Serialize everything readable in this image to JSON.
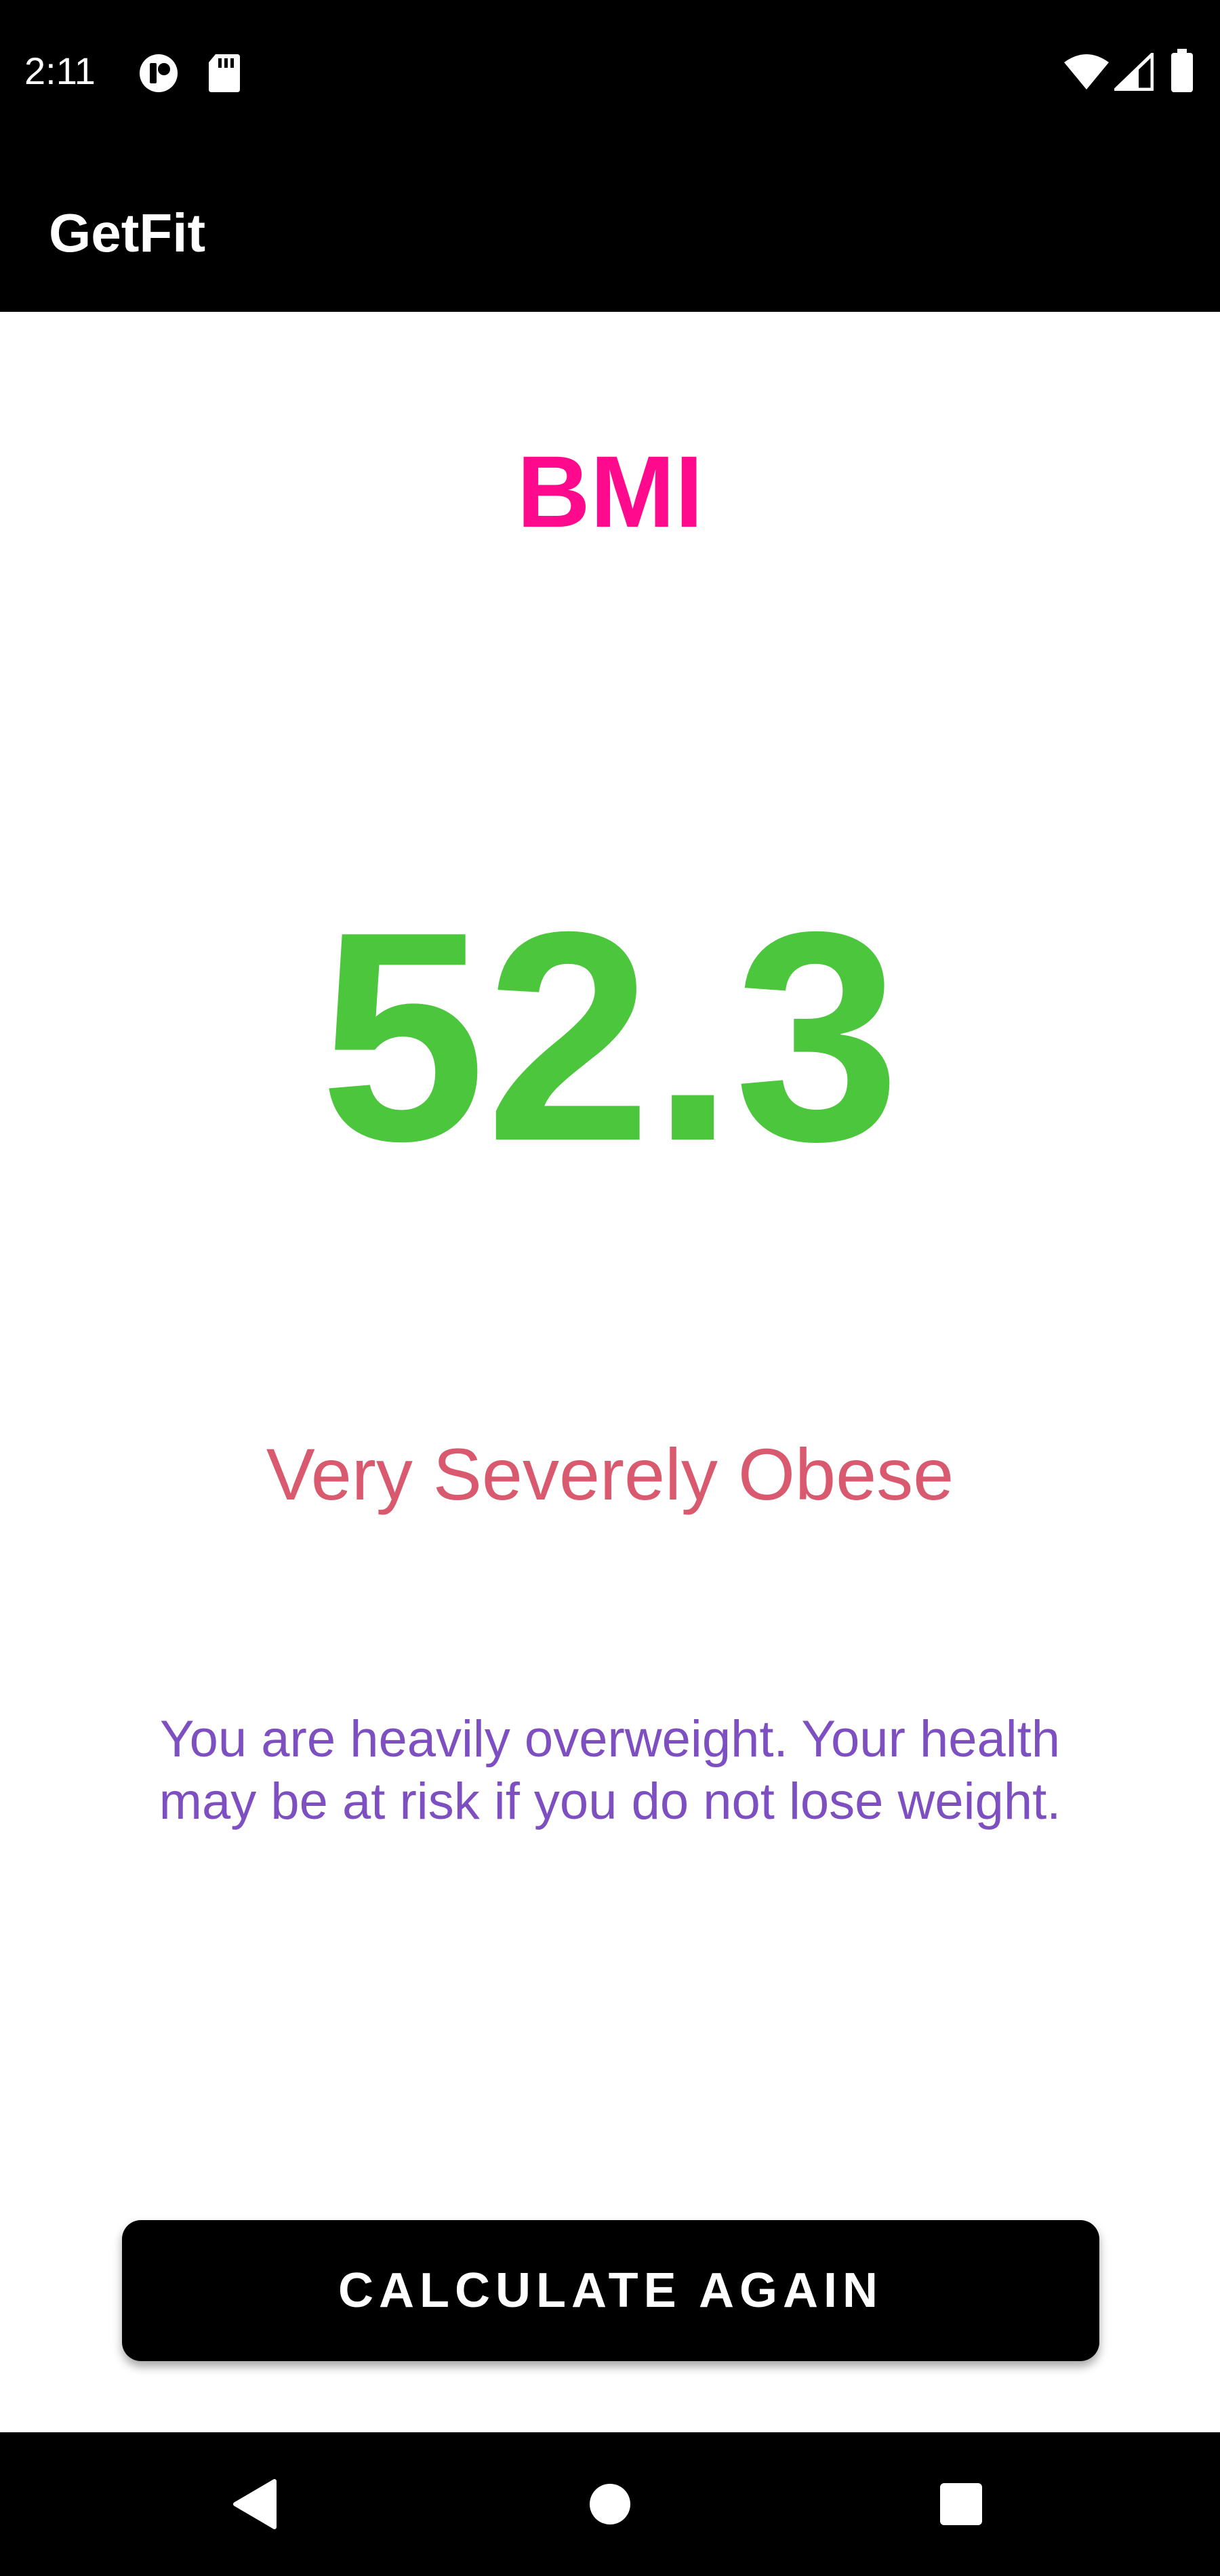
{
  "status_bar": {
    "time": "2:11",
    "icons": [
      "notification-app-icon",
      "sd-card-icon",
      "wifi-icon",
      "signal-icon",
      "battery-icon"
    ]
  },
  "app_bar": {
    "title": "GetFit"
  },
  "result": {
    "heading": "BMI",
    "value": "52.3",
    "category": "Very Severely Obese",
    "advice": "You are heavily overweight. Your health may be at risk if you do not lose weight."
  },
  "actions": {
    "calculate_again_label": "CALCULATE AGAIN"
  },
  "nav_bar": {
    "icons": [
      "back-icon",
      "home-icon",
      "recents-icon"
    ]
  },
  "colors": {
    "heading": "#FF0A8C",
    "value": "#4CC63C",
    "category": "#D95A6E",
    "advice": "#7E4FC0",
    "button_bg": "#000000",
    "button_text": "#FFFFFF"
  }
}
